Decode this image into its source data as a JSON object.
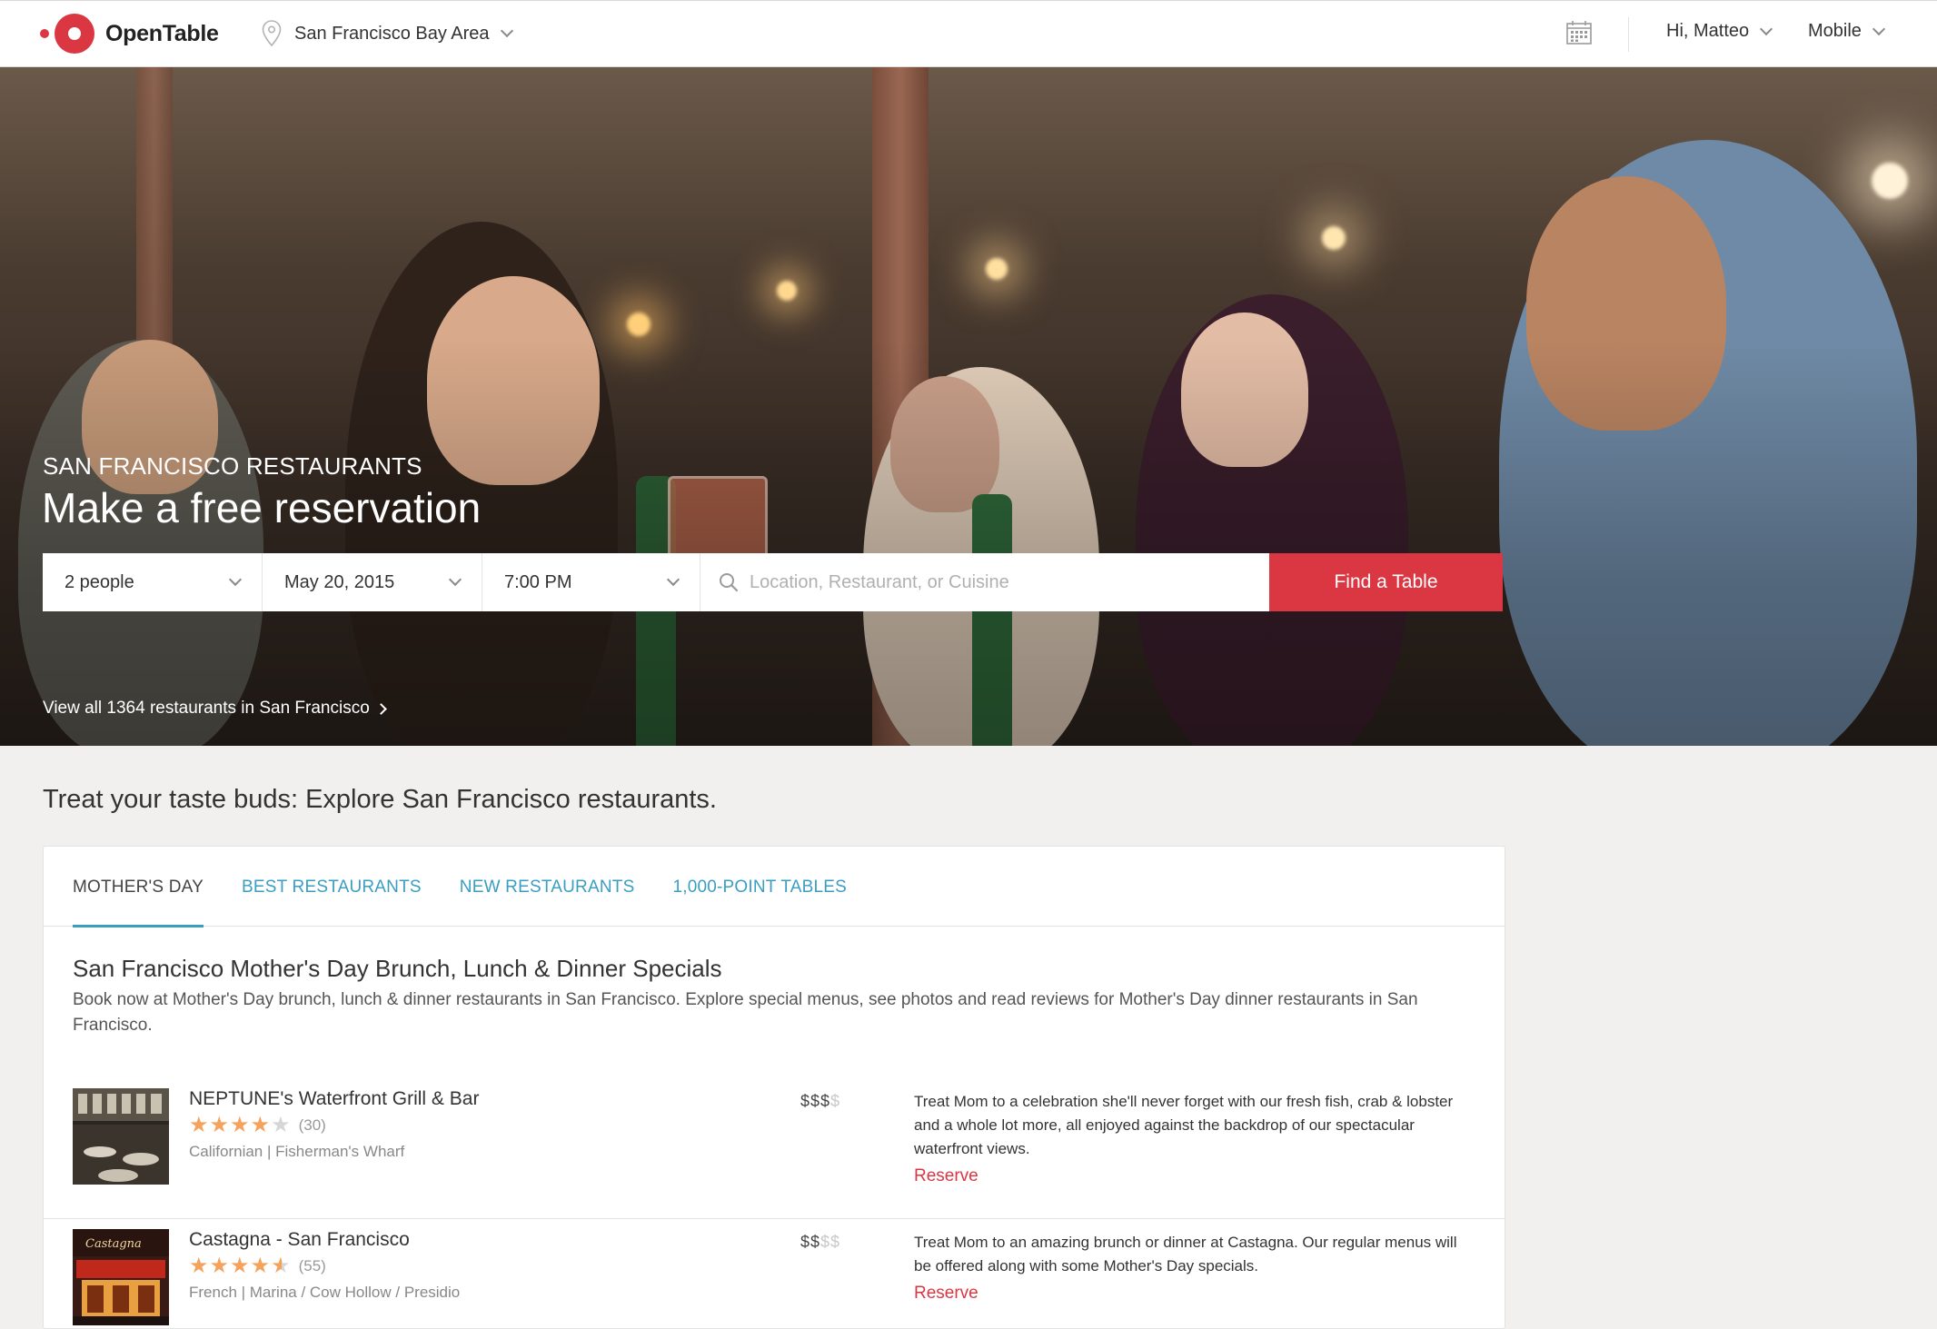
{
  "header": {
    "brand": "OpenTable",
    "location": "San Francisco Bay Area",
    "user_greeting": "Hi, Matteo",
    "mobile_label": "Mobile",
    "brand_color": "#da3743"
  },
  "hero": {
    "kicker": "SAN FRANCISCO RESTAURANTS",
    "title": "Make a free reservation",
    "party_size": "2 people",
    "date": "May 20, 2015",
    "time": "7:00 PM",
    "search_placeholder": "Location, Restaurant, or Cuisine",
    "find_button": "Find a Table",
    "view_all": "View all 1364 restaurants in San Francisco"
  },
  "main": {
    "tagline": "Treat your taste buds: Explore San Francisco restaurants.",
    "tabs": [
      {
        "label": "MOTHER'S DAY",
        "active": true
      },
      {
        "label": "BEST RESTAURANTS",
        "active": false
      },
      {
        "label": "NEW RESTAURANTS",
        "active": false
      },
      {
        "label": "1,000-POINT TABLES",
        "active": false
      }
    ],
    "section_title": "San Francisco Mother's Day Brunch, Lunch & Dinner Specials",
    "section_desc": "Book now at Mother's Day brunch, lunch & dinner restaurants in San Francisco. Explore special menus, see photos and read reviews for Mother's Day dinner restaurants in San Francisco.",
    "restaurants": [
      {
        "name": "NEPTUNE's Waterfront Grill & Bar",
        "rating": 4,
        "reviews": "(30)",
        "meta": "Californian | Fisherman's Wharf",
        "price_on": "$$$",
        "price_off": "$",
        "blurb": "Treat Mom to a celebration she'll never forget with our fresh fish, crab & lobster and a whole lot more, all enjoyed against the backdrop of our spectacular waterfront views.",
        "reserve": "Reserve"
      },
      {
        "name": "Castagna - San Francisco",
        "rating": 4.5,
        "reviews": "(55)",
        "meta": "French | Marina / Cow Hollow / Presidio",
        "price_on": "$$",
        "price_off": "$$",
        "blurb": "Treat Mom to an amazing brunch or dinner at Castagna. Our regular menus will be offered along with some Mother's Day specials.",
        "reserve": "Reserve"
      }
    ]
  }
}
